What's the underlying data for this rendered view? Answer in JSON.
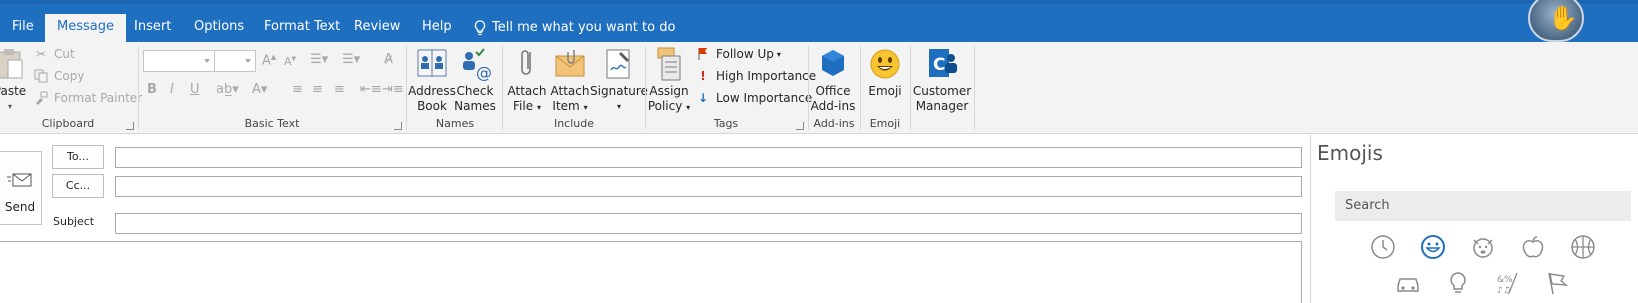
{
  "tabs": [
    {
      "label": "File",
      "active": false
    },
    {
      "label": "Message",
      "active": true
    },
    {
      "label": "Insert",
      "active": false
    },
    {
      "label": "Options",
      "active": false
    },
    {
      "label": "Format Text",
      "active": false
    },
    {
      "label": "Review",
      "active": false
    },
    {
      "label": "Help",
      "active": false
    }
  ],
  "tell_me": "Tell me what you want to do",
  "colors": {
    "accent": "#1e6fc0",
    "ribbon_bg": "#f3f3f3",
    "disabled": "#a8a8a8",
    "importance_high": "#c42b1c",
    "importance_low": "#1e6fc0",
    "follow_up_flag": "#d83b01"
  },
  "ribbon": {
    "clipboard": {
      "label": "Clipboard",
      "paste": "Paste",
      "cut": "Cut",
      "copy": "Copy",
      "format_painter": "Format Painter"
    },
    "basic_text": {
      "label": "Basic Text"
    },
    "names": {
      "label": "Names",
      "address_book": [
        "Address",
        "Book"
      ],
      "check_names": [
        "Check",
        "Names"
      ]
    },
    "include": {
      "label": "Include",
      "attach_file": [
        "Attach",
        "File"
      ],
      "attach_item": [
        "Attach",
        "Item"
      ],
      "signature": "Signature"
    },
    "tags": {
      "label": "Tags",
      "assign_policy": [
        "Assign",
        "Policy"
      ],
      "follow_up": "Follow Up",
      "high_importance": "High Importance",
      "low_importance": "Low Importance"
    },
    "addins": {
      "label": "Add-ins",
      "office_addins": [
        "Office",
        "Add-ins"
      ]
    },
    "emoji": {
      "label": "Emoji",
      "emoji_btn": "Emoji"
    },
    "customer_manager": {
      "label": [
        "Customer",
        "Manager"
      ]
    }
  },
  "compose": {
    "send": "Send",
    "to": "To...",
    "cc": "Cc...",
    "subject": "Subject"
  },
  "emoji_pane": {
    "title": "Emojis",
    "search_placeholder": "Search",
    "categories": [
      "recent-icon",
      "smiley-icon",
      "animal-icon",
      "food-icon",
      "sports-icon",
      "car-icon",
      "lightbulb-icon",
      "symbols-icon",
      "flags-icon"
    ],
    "selected_category": "smiley-icon"
  }
}
